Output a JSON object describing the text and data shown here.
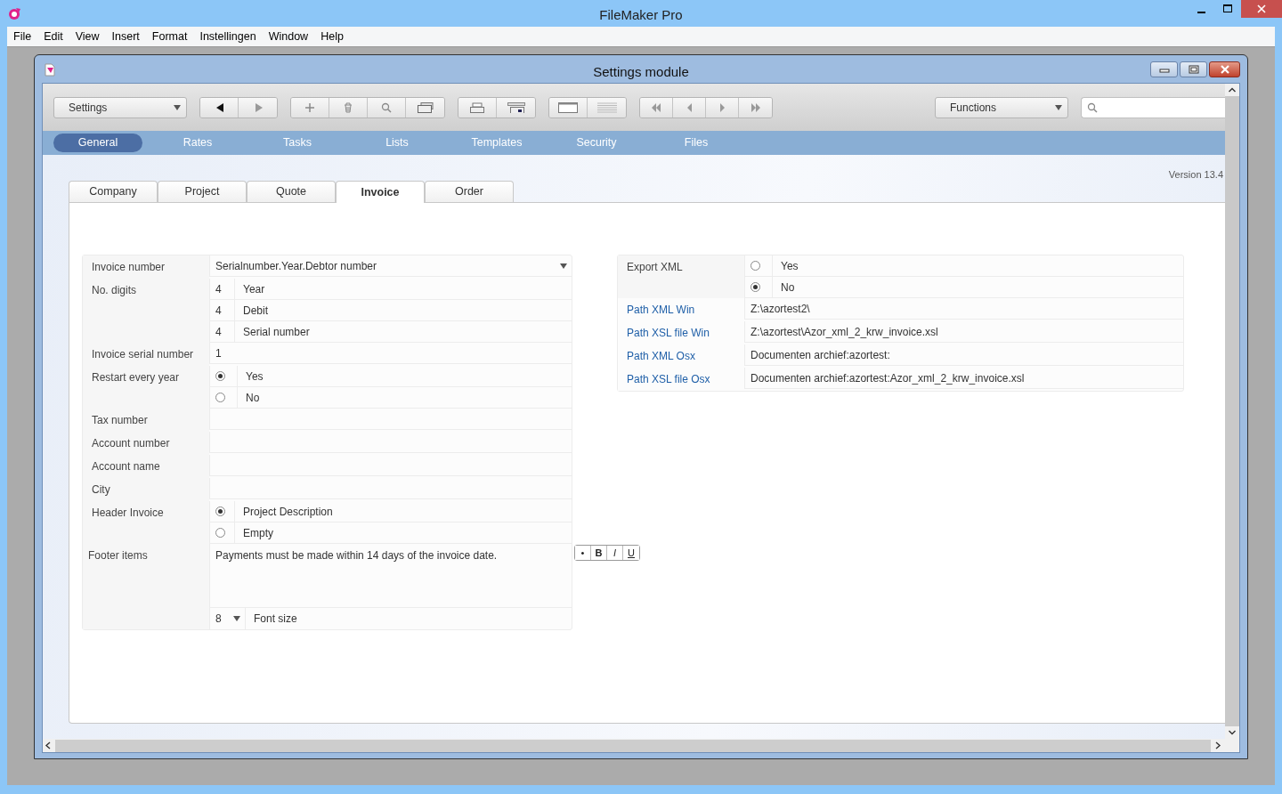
{
  "window": {
    "title": "FileMaker Pro"
  },
  "menu": [
    "File",
    "Edit",
    "View",
    "Insert",
    "Format",
    "Instellingen",
    "Window",
    "Help"
  ],
  "document": {
    "title": "Settings module"
  },
  "toolbar": {
    "layout_menu": "Settings",
    "functions_menu": "Functions"
  },
  "nav_tabs": [
    {
      "label": "General",
      "selected": true
    },
    {
      "label": "Rates",
      "selected": false
    },
    {
      "label": "Tasks",
      "selected": false
    },
    {
      "label": "Lists",
      "selected": false
    },
    {
      "label": "Templates",
      "selected": false
    },
    {
      "label": "Security",
      "selected": false
    },
    {
      "label": "Files",
      "selected": false
    }
  ],
  "version": "Version 13.4",
  "sub_tabs": [
    {
      "label": "Company",
      "selected": false
    },
    {
      "label": "Project",
      "selected": false
    },
    {
      "label": "Quote",
      "selected": false
    },
    {
      "label": "Invoice",
      "selected": true
    },
    {
      "label": "Order",
      "selected": false
    }
  ],
  "left_form": [
    {
      "kind": "select",
      "label": "Invoice number",
      "value": "Serialnumber.Year.Debtor number"
    },
    {
      "kind": "digits",
      "label": "No. digits",
      "items": [
        {
          "value": "4",
          "label": "Year"
        },
        {
          "value": "4",
          "label": "Debit"
        },
        {
          "value": "4",
          "label": "Serial number"
        }
      ]
    },
    {
      "kind": "text",
      "label": "Invoice serial number",
      "value": "1"
    },
    {
      "kind": "radio",
      "label": "Restart every year",
      "options": [
        {
          "label": "Yes",
          "selected": true
        },
        {
          "label": "No",
          "selected": false
        }
      ]
    },
    {
      "kind": "text",
      "label": "Tax number"
    },
    {
      "kind": "text",
      "label": "Account number"
    },
    {
      "kind": "text",
      "label": "Account name"
    },
    {
      "kind": "text",
      "label": "City"
    },
    {
      "kind": "radio",
      "label": "Header Invoice",
      "options": [
        {
          "label": "Project Description",
          "selected": true
        },
        {
          "label": "Empty",
          "selected": false
        }
      ]
    },
    {
      "kind": "footer",
      "label": "Footer items",
      "value": "Payments must be made within 14 days of the invoice date.",
      "format_buttons": [
        "•",
        "B",
        "I",
        "U"
      ],
      "font_size": {
        "value": "8",
        "label": "Font size"
      }
    }
  ],
  "right_form": [
    {
      "kind": "radio",
      "label": "Export XML",
      "options": [
        {
          "label": "Yes",
          "selected": false
        },
        {
          "label": "No",
          "selected": true
        }
      ]
    },
    {
      "kind": "path",
      "label": "Path XML Win",
      "value": "Z:\\azortest2\\"
    },
    {
      "kind": "path",
      "label": "Path XSL file Win",
      "value": "Z:\\azortest\\Azor_xml_2_krw_invoice.xsl"
    },
    {
      "kind": "path",
      "label": "Path XML Osx",
      "value": "Documenten archief:azortest:"
    },
    {
      "kind": "path",
      "label": "Path XSL file Osx",
      "value": "Documenten archief:azortest:Azor_xml_2_krw_invoice.xsl"
    }
  ]
}
